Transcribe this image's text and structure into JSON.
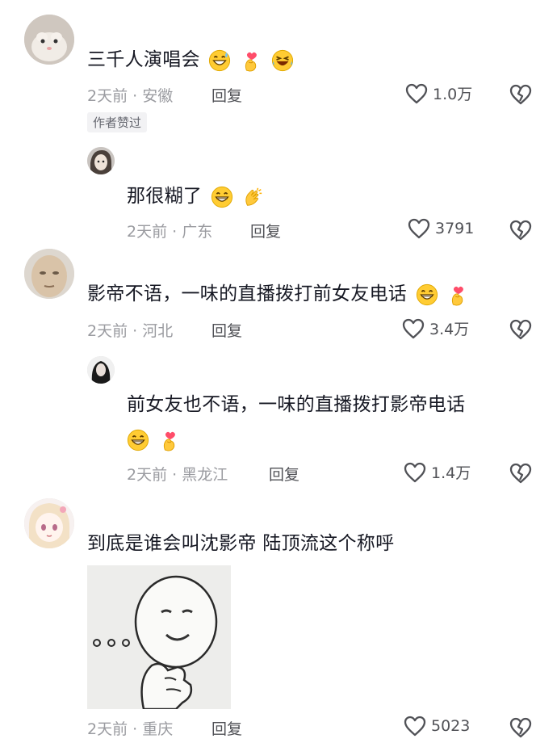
{
  "comments": [
    {
      "text": "三千人演唱会",
      "time": "2天前",
      "location": "安徽",
      "reply_label": "回复",
      "likes": "1.0万",
      "badge": "作者赞过"
    },
    {
      "text": "那很糊了",
      "time": "2天前",
      "location": "广东",
      "reply_label": "回复",
      "likes": "3791"
    },
    {
      "text": "影帝不语，一味的直播拨打前女友电话",
      "time": "2天前",
      "location": "河北",
      "reply_label": "回复",
      "likes": "3.4万"
    },
    {
      "text": "前女友也不语，一味的直播拨打影帝电话",
      "time": "2天前",
      "location": "黑龙江",
      "reply_label": "回复",
      "likes": "1.4万"
    },
    {
      "text": "到底是谁会叫沈影帝 陆顶流这个称呼",
      "time": "2天前",
      "location": "重庆",
      "reply_label": "回复",
      "likes": "5023"
    }
  ],
  "colors": {
    "text": "#161823",
    "meta": "#9a9ba0",
    "action": "#505156",
    "badge_bg": "#f2f2f4"
  }
}
